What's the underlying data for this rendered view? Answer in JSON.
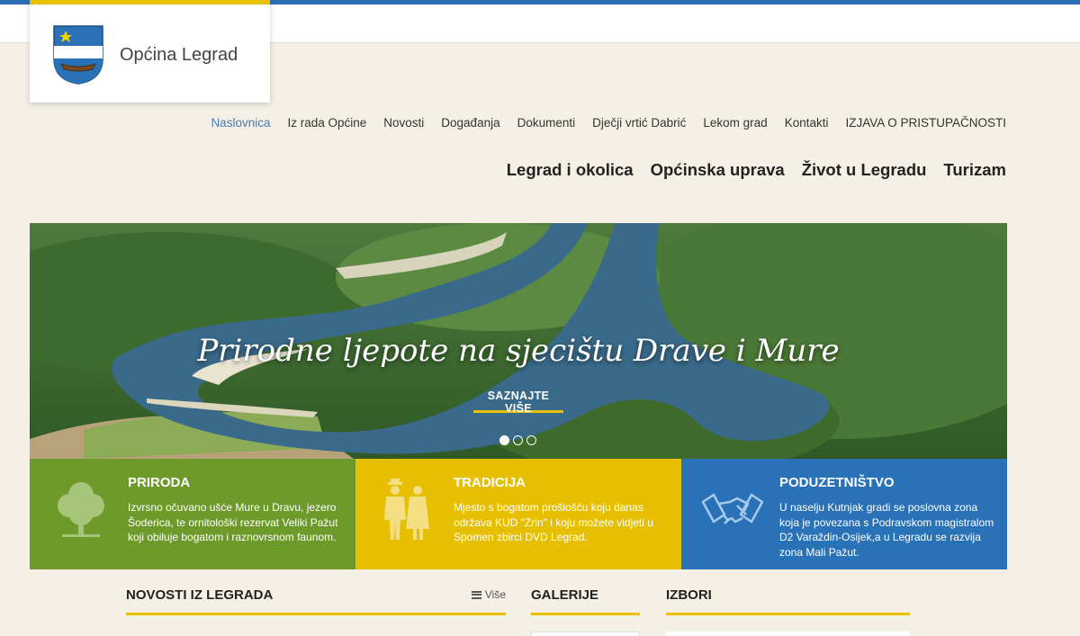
{
  "site": {
    "name": "Općina Legrad"
  },
  "top_nav": {
    "items": [
      {
        "label": "Naslovnica",
        "active": true
      },
      {
        "label": "Iz rada Općine"
      },
      {
        "label": "Novosti"
      },
      {
        "label": "Događanja"
      },
      {
        "label": "Dokumenti"
      },
      {
        "label": "Dječji vrtić Dabrić"
      },
      {
        "label": "Lekom grad"
      },
      {
        "label": "Kontakti"
      },
      {
        "label": "IZJAVA O PRISTUPAČNOSTI"
      }
    ]
  },
  "main_nav": {
    "items": [
      {
        "label": "Legrad i okolica"
      },
      {
        "label": "Općinska uprava"
      },
      {
        "label": "Život u Legradu"
      },
      {
        "label": "Turizam"
      }
    ]
  },
  "hero": {
    "title": "Prirodne ljepote na sjecištu Drave i Mure",
    "button": "SAZNAJTE VIŠE",
    "slides": 3,
    "active_slide": 1
  },
  "tiles": [
    {
      "title": "PRIRODA",
      "text": "Izvrsno očuvano ušće Mure u Dravu, jezero Šoderica, te ornitološki rezervat Veliki Pažut koji obiluje bogatom i raznovrsnom faunom.",
      "icon": "tree-icon",
      "color": "#6d9a2a"
    },
    {
      "title": "TRADICIJA",
      "text": "Mjesto s bogatom prošlošću koju danas održava KUD \"Zrin\" i koju možete vidjeti u Spomen zbirci DVD Legrad.",
      "icon": "folk-couple-icon",
      "color": "#e6bf00"
    },
    {
      "title": "PODUZETNIŠTVO",
      "text": "U naselju Kutnjak gradi se poslovna zona koja je povezana s Podravskom magistralom D2 Varaždin-Osijek,a u Legradu se razvija zona Mali Pažut.",
      "icon": "handshake-icon",
      "color": "#2a72b8"
    }
  ],
  "sections": {
    "news": {
      "title": "NOVOSTI IZ LEGRADA",
      "more": "Više"
    },
    "gallery": {
      "title": "GALERIJE"
    },
    "elections": {
      "title": "IZBORI"
    }
  },
  "colors": {
    "accent": "#e9c000",
    "topbar": "#2a6fb0",
    "link_active": "#4a7ab5"
  }
}
